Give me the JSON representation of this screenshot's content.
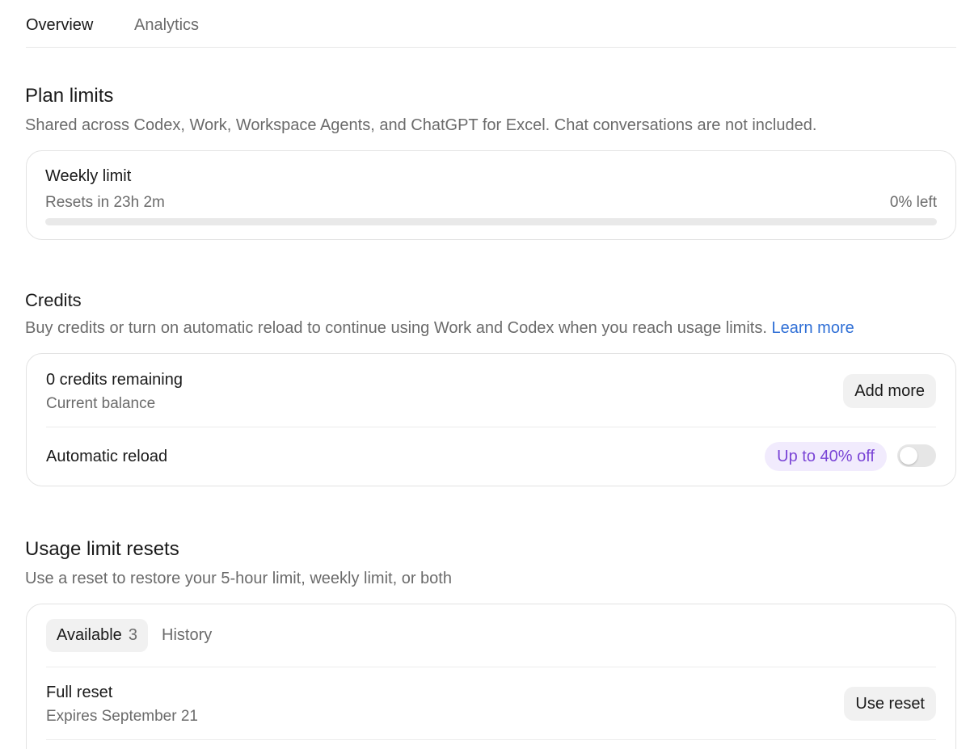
{
  "tabs": [
    {
      "label": "Overview",
      "active": true
    },
    {
      "label": "Analytics",
      "active": false
    }
  ],
  "plan_limits": {
    "title": "Plan limits",
    "description": "Shared across Codex, Work, Workspace Agents, and ChatGPT for Excel. Chat conversations are not included.",
    "weekly": {
      "title": "Weekly limit",
      "reset_text": "Resets in 23h 2m",
      "left_text": "0% left",
      "used_fraction": 0
    }
  },
  "credits": {
    "title": "Credits",
    "description": "Buy credits or turn on automatic reload to continue using Work and Codex when you reach usage limits.",
    "learn_more": "Learn more",
    "remaining": "0 credits remaining",
    "balance_label": "Current balance",
    "add_more": "Add more",
    "auto_reload_label": "Automatic reload",
    "discount_badge": "Up to 40% off",
    "auto_reload_on": false
  },
  "usage_resets": {
    "title": "Usage limit resets",
    "description": "Use a reset to restore your 5-hour limit, weekly limit, or both",
    "tab_available": "Available",
    "available_count": "3",
    "tab_history": "History",
    "items": [
      {
        "title": "Full reset",
        "expires": "Expires September 21",
        "button": "Use reset"
      }
    ]
  },
  "colors": {
    "link": "#2f6fd6",
    "badge_bg": "#f1ebfd",
    "badge_text": "#7a45d6",
    "muted_text": "#6b6b6b"
  }
}
